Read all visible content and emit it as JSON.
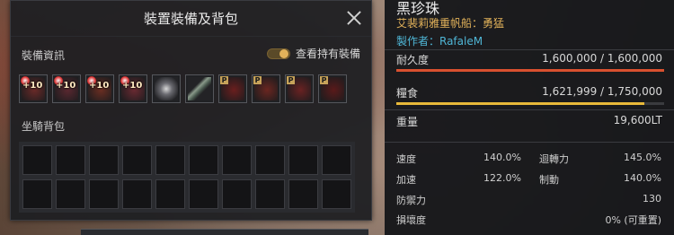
{
  "window": {
    "title": "裝置裝備及背包",
    "equip_section": "裝備資訊",
    "toggle_label": "查看持有裝備",
    "toggle_on": true,
    "bag_section": "坐騎背包",
    "equip_slots": [
      {
        "name": "slot-1",
        "enhance": "+10",
        "icon": "hull-icon",
        "color": "#6a2a28"
      },
      {
        "name": "slot-2",
        "enhance": "+10",
        "icon": "cannon-icon",
        "color": "#5a2830"
      },
      {
        "name": "slot-3",
        "enhance": "+10",
        "icon": "sail-icon",
        "color": "#6b2e22"
      },
      {
        "name": "slot-4",
        "enhance": "+10",
        "icon": "figurehead-icon",
        "color": "#6a2a32"
      },
      {
        "name": "slot-5",
        "enhance": "",
        "icon": "crystal-icon",
        "color": "#3a3a3e"
      },
      {
        "name": "slot-6",
        "enhance": "",
        "icon": "spyglass-icon",
        "color": "#2e3438"
      },
      {
        "name": "slot-7",
        "enhance": "",
        "icon": "ship-part-icon",
        "color": "#6a1e1e",
        "badge": "P"
      },
      {
        "name": "slot-8",
        "enhance": "",
        "icon": "dragon-ornament-icon",
        "color": "#6a2620",
        "badge": "P"
      },
      {
        "name": "slot-9",
        "enhance": "",
        "icon": "cannon-deco-icon",
        "color": "#6a2222",
        "badge": "P"
      },
      {
        "name": "slot-10",
        "enhance": "",
        "icon": "skull-flag-icon",
        "color": "#5a1a1a",
        "badge": "P"
      }
    ],
    "bag_cells": 20
  },
  "info": {
    "ship_name": "黑珍珠",
    "ship_type": "艾裴莉雅重帆船：勇猛",
    "maker": "製作者：RafaleM",
    "durability_label": "耐久度",
    "durability_value": "1,600,000 / 1,600,000",
    "durability_fraction": 1.0,
    "food_label": "糧食",
    "food_value": "1,621,999 / 1,750,000",
    "food_fraction": 0.927,
    "weight_label": "重量",
    "weight_value": "19,600LT",
    "speed_label": "速度",
    "speed_value": "140.0%",
    "turn_label": "迴轉力",
    "turn_value": "145.0%",
    "accel_label": "加速",
    "accel_value": "122.0%",
    "brake_label": "制動",
    "brake_value": "140.0%",
    "defense_label": "防禦力",
    "defense_value": "130",
    "damage_label": "損壞度",
    "damage_value": "0% (可重置)",
    "colors": {
      "durability": "#d9502f",
      "food": "#e8b93a",
      "accent": "#e2b25a",
      "maker": "#4fb6d6"
    }
  }
}
